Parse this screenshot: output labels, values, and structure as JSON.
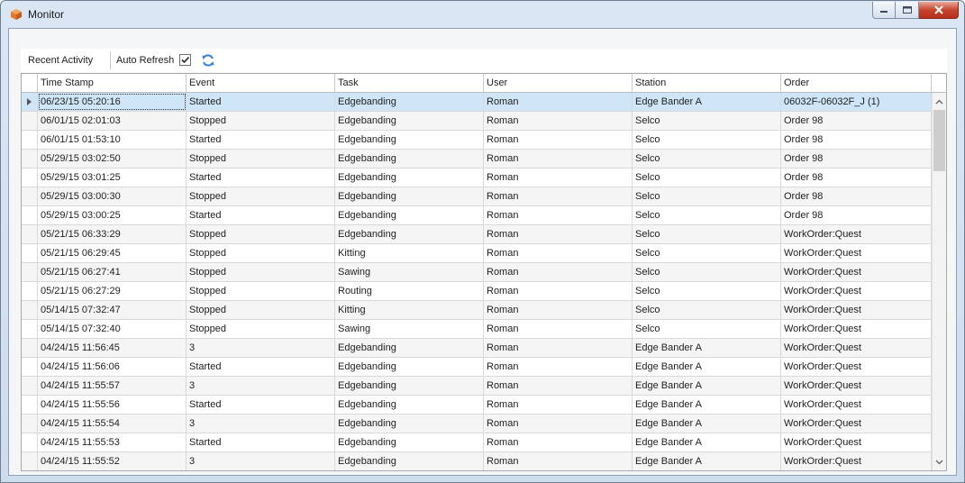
{
  "window": {
    "title": "Monitor"
  },
  "toolbar": {
    "recent_activity": "Recent Activity",
    "auto_refresh": "Auto Refresh",
    "auto_refresh_checked": true
  },
  "grid": {
    "columns": [
      "Time Stamp",
      "Event",
      "Task",
      "User",
      "Station",
      "Order"
    ],
    "rows": [
      [
        "06/23/15 05:20:16",
        "Started",
        "Edgebanding",
        "Roman",
        "Edge Bander A",
        "06032F-06032F_J (1)"
      ],
      [
        "06/01/15 02:01:03",
        "Stopped",
        "Edgebanding",
        "Roman",
        "Selco",
        "Order 98"
      ],
      [
        "06/01/15 01:53:10",
        "Started",
        "Edgebanding",
        "Roman",
        "Selco",
        "Order 98"
      ],
      [
        "05/29/15 03:02:50",
        "Stopped",
        "Edgebanding",
        "Roman",
        "Selco",
        "Order 98"
      ],
      [
        "05/29/15 03:01:25",
        "Started",
        "Edgebanding",
        "Roman",
        "Selco",
        "Order 98"
      ],
      [
        "05/29/15 03:00:30",
        "Stopped",
        "Edgebanding",
        "Roman",
        "Selco",
        "Order 98"
      ],
      [
        "05/29/15 03:00:25",
        "Started",
        "Edgebanding",
        "Roman",
        "Selco",
        "Order 98"
      ],
      [
        "05/21/15 06:33:29",
        "Stopped",
        "Edgebanding",
        "Roman",
        "Selco",
        "WorkOrder:Quest"
      ],
      [
        "05/21/15 06:29:45",
        "Stopped",
        "Kitting",
        "Roman",
        "Selco",
        "WorkOrder:Quest"
      ],
      [
        "05/21/15 06:27:41",
        "Stopped",
        "Sawing",
        "Roman",
        "Selco",
        "WorkOrder:Quest"
      ],
      [
        "05/21/15 06:27:29",
        "Stopped",
        "Routing",
        "Roman",
        "Selco",
        "WorkOrder:Quest"
      ],
      [
        "05/14/15 07:32:47",
        "Stopped",
        "Kitting",
        "Roman",
        "Selco",
        "WorkOrder:Quest"
      ],
      [
        "05/14/15 07:32:40",
        "Stopped",
        "Sawing",
        "Roman",
        "Selco",
        "WorkOrder:Quest"
      ],
      [
        "04/24/15 11:56:45",
        "3",
        "Edgebanding",
        "Roman",
        "Edge Bander A",
        "WorkOrder:Quest"
      ],
      [
        "04/24/15 11:56:06",
        "Started",
        "Edgebanding",
        "Roman",
        "Edge Bander A",
        "WorkOrder:Quest"
      ],
      [
        "04/24/15 11:55:57",
        "3",
        "Edgebanding",
        "Roman",
        "Edge Bander A",
        "WorkOrder:Quest"
      ],
      [
        "04/24/15 11:55:56",
        "Started",
        "Edgebanding",
        "Roman",
        "Edge Bander A",
        "WorkOrder:Quest"
      ],
      [
        "04/24/15 11:55:54",
        "3",
        "Edgebanding",
        "Roman",
        "Edge Bander A",
        "WorkOrder:Quest"
      ],
      [
        "04/24/15 11:55:53",
        "Started",
        "Edgebanding",
        "Roman",
        "Edge Bander A",
        "WorkOrder:Quest"
      ],
      [
        "04/24/15 11:55:52",
        "3",
        "Edgebanding",
        "Roman",
        "Edge Bander A",
        "WorkOrder:Quest"
      ]
    ],
    "selected_row": 0
  },
  "icons": {
    "app": "package-icon",
    "refresh": "refresh-icon",
    "minimize": "minimize-icon",
    "maximize": "maximize-icon",
    "close": "close-icon"
  },
  "colors": {
    "selection": "#cfe6f8",
    "close_button": "#c6452e",
    "app_icon_orange": "#e07a2c",
    "refresh_blue": "#2f7fd3"
  }
}
